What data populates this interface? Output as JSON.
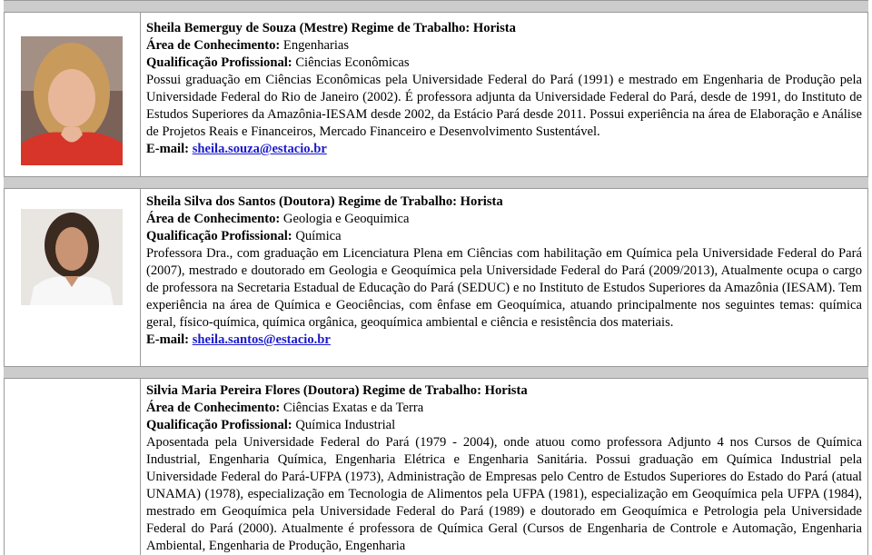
{
  "profiles": [
    {
      "name_line": "Sheila Bemerguy de Souza (Mestre) Regime de Trabalho: Horista",
      "area_label": "Área de Conhecimento:",
      "area_value": "Engenharias",
      "qual_label": "Qualificação Profissional:",
      "qual_value": "Ciências Econômicas",
      "bio": "Possui graduação em Ciências Econômicas pela Universidade Federal do Pará (1991) e mestrado em Engenharia de Produção pela Universidade Federal do Rio de Janeiro (2002). É professora adjunta da Universidade Federal do Pará, desde de 1991, do Instituto de Estudos Superiores da Amazônia-IESAM desde 2002, da Estácio Pará desde 2011. Possui experiência na área de Elaboração e Análise de Projetos Reais e Financeiros, Mercado Financeiro e Desenvolvimento Sustentável.",
      "email_label": "E-mail:",
      "email": "sheila.souza@estacio.br"
    },
    {
      "name_line": "Sheila Silva dos Santos (Doutora) Regime de Trabalho: Horista",
      "area_label": "Área de Conhecimento:",
      "area_value": "Geologia e Geoquimica",
      "qual_label": "Qualificação Profissional:",
      "qual_value": "Química",
      "bio": "Professora Dra., com graduação em Licenciatura Plena em Ciências com habilitação em Química pela Universidade Federal do Pará (2007), mestrado e doutorado em Geologia e Geoquímica pela Universidade Federal do Pará (2009/2013), Atualmente ocupa o cargo de professora na Secretaria Estadual de Educação do Pará (SEDUC) e no Instituto de Estudos Superiores da Amazônia (IESAM). Tem experiência na área de Química e Geociências, com ênfase em Geoquímica, atuando principalmente nos seguintes temas: química geral, físico-química, química orgânica, geoquímica ambiental e ciência e resistência dos materiais.",
      "email_label": "E-mail:",
      "email": "sheila.santos@estacio.br"
    },
    {
      "name_line": "Silvia Maria Pereira Flores (Doutora) Regime de Trabalho: Horista",
      "area_label": "Área de Conhecimento:",
      "area_value": "Ciências Exatas e da Terra",
      "qual_label": "Qualificação Profissional:",
      "qual_value": "Química Industrial",
      "bio": "Aposentada pela Universidade Federal do Pará (1979 - 2004), onde atuou como professora Adjunto 4 nos Cursos de Química Industrial, Engenharia Química, Engenharia Elétrica e Engenharia Sanitária. Possui graduação em Química Industrial pela Universidade Federal do Pará-UFPA (1973), Administração de Empresas pelo Centro de Estudos Superiores do Estado do Pará (atual UNAMA) (1978), especialização em Tecnologia de Alimentos pela UFPA (1981), especialização em Geoquímica pela UFPA (1984), mestrado em Geoquímica pela Universidade Federal do Pará (1989) e doutorado em Geoquímica e Petrologia pela Universidade Federal do Pará (2000). Atualmente é professora de Química Geral (Cursos de Engenharia de Controle e Automação, Engenharia Ambiental, Engenharia de Produção, Engenharia"
    }
  ]
}
